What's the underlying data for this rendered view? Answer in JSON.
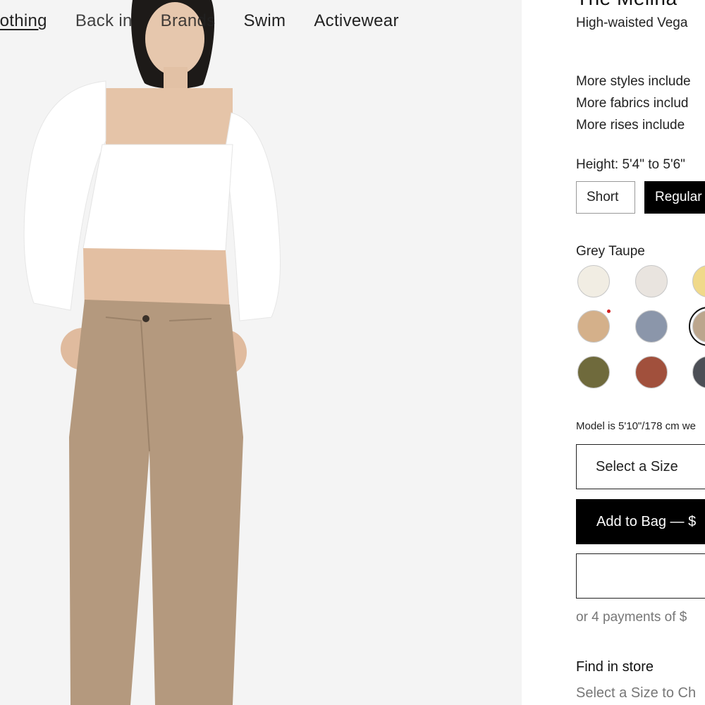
{
  "nav": {
    "items": [
      "lothing",
      "Back in",
      "Brands",
      "Swim",
      "Activewear"
    ]
  },
  "product": {
    "title": "The Melina",
    "subtitle": "High-waisted Vega",
    "more_styles": "More styles include",
    "more_fabrics": "More fabrics includ",
    "more_rises": "More rises include",
    "height_label": "Height: 5'4\" to 5'6\"",
    "height_options": [
      "Short",
      "Regular"
    ],
    "selected_height": "Regular",
    "color_name": "Grey Taupe",
    "swatches": [
      {
        "name": "cream",
        "hex": "#f1ede3"
      },
      {
        "name": "light-grey-beige",
        "hex": "#e9e4df"
      },
      {
        "name": "butter-yellow",
        "hex": "#f0d98a"
      },
      {
        "name": "tan",
        "hex": "#d4b08a",
        "new": true
      },
      {
        "name": "slate-blue",
        "hex": "#8b96aa"
      },
      {
        "name": "grey-taupe",
        "hex": "#bca68d",
        "selected": true
      },
      {
        "name": "olive",
        "hex": "#6f6a3c"
      },
      {
        "name": "rust",
        "hex": "#a1503c"
      },
      {
        "name": "charcoal",
        "hex": "#4c4f56"
      }
    ],
    "model_note": "Model is 5'10\"/178 cm we",
    "size_select": "Select a Size",
    "add_to_bag": "Add to Bag — $",
    "payments": "or 4 payments of $",
    "find_in_store": "Find in store",
    "find_sub": "Select a Size to Ch"
  }
}
